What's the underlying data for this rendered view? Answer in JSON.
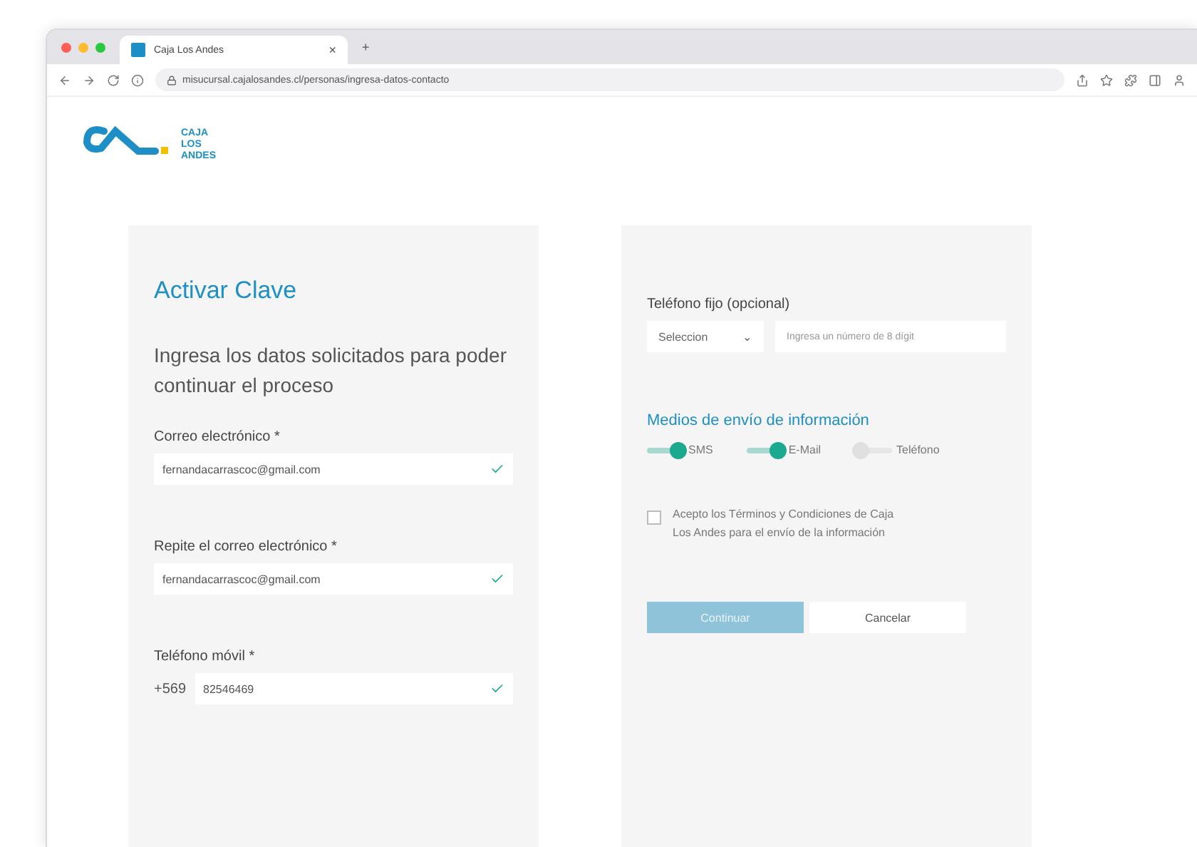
{
  "browser": {
    "tab_title": "Caja Los Andes",
    "tab_close": "×",
    "new_tab": "+",
    "url": "misucursal.cajalosandes.cl/personas/ingresa-datos-contacto"
  },
  "logo": {
    "lines": [
      "CAJA",
      "LOS",
      "ANDES"
    ]
  },
  "left_card": {
    "title": "Activar Clave",
    "subtitle": "Ingresa los datos solicitados para poder continuar el proceso",
    "fields": [
      {
        "label": "Correo electrónico *",
        "value": "fernandacarrascoc@gmail.com",
        "valid": true
      },
      {
        "label": "Repite el correo electrónico *",
        "value": "fernandacarrascoc@gmail.com",
        "valid": true
      },
      {
        "label": "Teléfono móvil *",
        "prefix": "+569",
        "value": "82546469",
        "valid": true
      }
    ]
  },
  "right_card": {
    "phone_label": "Teléfono fijo (opcional)",
    "select": "Seleccion",
    "select_caret": "⌄",
    "phone_placeholder": "Ingresa un número de 8 dígit",
    "section_title": "Medios de envío de información",
    "toggles": [
      {
        "label": "SMS",
        "on": true
      },
      {
        "label": "E-Mail",
        "on": true
      },
      {
        "label": "Teléfono",
        "on": false
      }
    ],
    "terms": {
      "text": "Acepto los Términos y Condiciones de Caja Los Andes para el envío de la información",
      "checked": false
    },
    "buttons": [
      {
        "label": "Continuar",
        "kind": "primary",
        "disabled": true
      },
      {
        "label": "Cancelar",
        "kind": "secondary"
      }
    ]
  }
}
